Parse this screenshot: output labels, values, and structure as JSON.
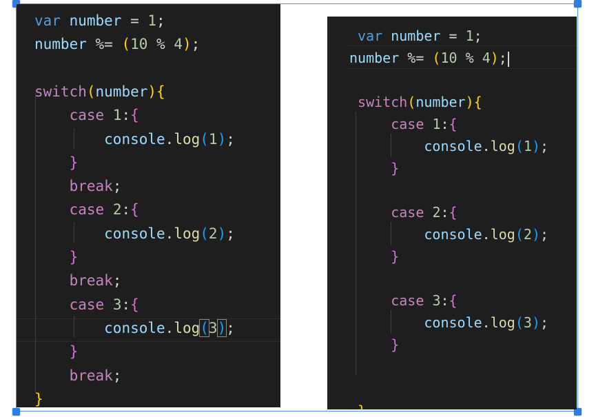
{
  "left_editor": {
    "lines": [
      {
        "t": [
          [
            "var",
            "kw-var"
          ],
          [
            " ",
            ""
          ],
          [
            "number",
            "ident"
          ],
          [
            " = ",
            ""
          ],
          [
            "1",
            "num"
          ],
          [
            ";",
            ""
          ]
        ]
      },
      {
        "t": [
          [
            "number",
            "ident"
          ],
          [
            " %= ",
            ""
          ],
          [
            "(",
            "brace"
          ],
          [
            "10",
            "num"
          ],
          [
            " % ",
            ""
          ],
          [
            "4",
            "num"
          ],
          [
            ")",
            "brace"
          ],
          [
            ";",
            ""
          ]
        ]
      },
      {
        "t": []
      },
      {
        "t": [
          [
            "switch",
            "kw-ctrl"
          ],
          [
            "(",
            "brace"
          ],
          [
            "number",
            "ident"
          ],
          [
            ")",
            "brace"
          ],
          [
            "{",
            "brace"
          ]
        ]
      },
      {
        "t": [
          [
            "    ",
            ""
          ],
          [
            "case",
            "kw-ctrl"
          ],
          [
            " ",
            ""
          ],
          [
            "1",
            "num"
          ],
          [
            ":",
            ""
          ],
          [
            "{",
            "paren"
          ]
        ]
      },
      {
        "t": [
          [
            "        ",
            ""
          ],
          [
            "console",
            "ident"
          ],
          [
            ".",
            ""
          ],
          [
            "log",
            "fn"
          ],
          [
            "(",
            "paren2"
          ],
          [
            "1",
            "num"
          ],
          [
            ")",
            "paren2"
          ],
          [
            ";",
            ""
          ]
        ]
      },
      {
        "t": [
          [
            "    ",
            ""
          ],
          [
            "}",
            "paren"
          ]
        ]
      },
      {
        "t": [
          [
            "    ",
            ""
          ],
          [
            "break",
            "kw-ctrl"
          ],
          [
            ";",
            ""
          ]
        ]
      },
      {
        "t": [
          [
            "    ",
            ""
          ],
          [
            "case",
            "kw-ctrl"
          ],
          [
            " ",
            ""
          ],
          [
            "2",
            "num"
          ],
          [
            ":",
            ""
          ],
          [
            "{",
            "paren"
          ]
        ]
      },
      {
        "t": [
          [
            "        ",
            ""
          ],
          [
            "console",
            "ident"
          ],
          [
            ".",
            ""
          ],
          [
            "log",
            "fn"
          ],
          [
            "(",
            "paren2"
          ],
          [
            "2",
            "num"
          ],
          [
            ")",
            "paren2"
          ],
          [
            ";",
            ""
          ]
        ]
      },
      {
        "t": [
          [
            "    ",
            ""
          ],
          [
            "}",
            "paren"
          ]
        ]
      },
      {
        "t": [
          [
            "    ",
            ""
          ],
          [
            "break",
            "kw-ctrl"
          ],
          [
            ";",
            ""
          ]
        ]
      },
      {
        "t": [
          [
            "    ",
            ""
          ],
          [
            "case",
            "kw-ctrl"
          ],
          [
            " ",
            ""
          ],
          [
            "3",
            "num"
          ],
          [
            ":",
            ""
          ],
          [
            "{",
            "paren"
          ]
        ]
      },
      {
        "t": [
          [
            "        ",
            ""
          ],
          [
            "console",
            "ident"
          ],
          [
            ".",
            ""
          ],
          [
            "log",
            "fn"
          ],
          [
            "(",
            "paren2 bracket-box"
          ],
          [
            "3",
            "num"
          ],
          [
            ")",
            "paren2 bracket-box"
          ],
          [
            ";",
            ""
          ]
        ]
      },
      {
        "t": [
          [
            "    ",
            ""
          ],
          [
            "}",
            "paren"
          ]
        ]
      },
      {
        "t": [
          [
            "    ",
            ""
          ],
          [
            "break",
            "kw-ctrl"
          ],
          [
            ";",
            ""
          ]
        ]
      },
      {
        "t": [
          [
            "}",
            "brace"
          ]
        ]
      }
    ]
  },
  "right_editor": {
    "lines": [
      {
        "t": [
          [
            " ",
            ""
          ],
          [
            "var",
            "kw-var"
          ],
          [
            " ",
            ""
          ],
          [
            "number",
            "ident"
          ],
          [
            " = ",
            ""
          ],
          [
            "1",
            "num"
          ],
          [
            ";",
            ""
          ]
        ]
      },
      {
        "t": [
          [
            "number",
            "ident"
          ],
          [
            " %= ",
            ""
          ],
          [
            "(",
            "brace"
          ],
          [
            "10",
            "num"
          ],
          [
            " % ",
            ""
          ],
          [
            "4",
            "num"
          ],
          [
            ")",
            "brace"
          ],
          [
            ";",
            ""
          ]
        ]
      },
      {
        "t": []
      },
      {
        "t": [
          [
            " ",
            ""
          ],
          [
            "switch",
            "kw-ctrl"
          ],
          [
            "(",
            "brace"
          ],
          [
            "number",
            "ident"
          ],
          [
            ")",
            "brace"
          ],
          [
            "{",
            "brace"
          ]
        ]
      },
      {
        "t": [
          [
            "     ",
            ""
          ],
          [
            "case",
            "kw-ctrl"
          ],
          [
            " ",
            ""
          ],
          [
            "1",
            "num"
          ],
          [
            ":",
            ""
          ],
          [
            "{",
            "paren"
          ]
        ]
      },
      {
        "t": [
          [
            "         ",
            ""
          ],
          [
            "console",
            "ident"
          ],
          [
            ".",
            ""
          ],
          [
            "log",
            "fn"
          ],
          [
            "(",
            "paren2"
          ],
          [
            "1",
            "num"
          ],
          [
            ")",
            "paren2"
          ],
          [
            ";",
            ""
          ]
        ]
      },
      {
        "t": [
          [
            "     ",
            ""
          ],
          [
            "}",
            "paren"
          ]
        ]
      },
      {
        "t": []
      },
      {
        "t": [
          [
            "     ",
            ""
          ],
          [
            "case",
            "kw-ctrl"
          ],
          [
            " ",
            ""
          ],
          [
            "2",
            "num"
          ],
          [
            ":",
            ""
          ],
          [
            "{",
            "paren"
          ]
        ]
      },
      {
        "t": [
          [
            "         ",
            ""
          ],
          [
            "console",
            "ident"
          ],
          [
            ".",
            ""
          ],
          [
            "log",
            "fn"
          ],
          [
            "(",
            "paren2"
          ],
          [
            "2",
            "num"
          ],
          [
            ")",
            "paren2"
          ],
          [
            ";",
            ""
          ]
        ]
      },
      {
        "t": [
          [
            "     ",
            ""
          ],
          [
            "}",
            "paren"
          ]
        ]
      },
      {
        "t": []
      },
      {
        "t": [
          [
            "     ",
            ""
          ],
          [
            "case",
            "kw-ctrl"
          ],
          [
            " ",
            ""
          ],
          [
            "3",
            "num"
          ],
          [
            ":",
            ""
          ],
          [
            "{",
            "paren"
          ]
        ]
      },
      {
        "t": [
          [
            "         ",
            ""
          ],
          [
            "console",
            "ident"
          ],
          [
            ".",
            ""
          ],
          [
            "log",
            "fn"
          ],
          [
            "(",
            "paren2"
          ],
          [
            "3",
            "num"
          ],
          [
            ")",
            "paren2"
          ],
          [
            ";",
            ""
          ]
        ]
      },
      {
        "t": [
          [
            "     ",
            ""
          ],
          [
            "}",
            "paren"
          ]
        ]
      },
      {
        "t": []
      },
      {
        "t": []
      },
      {
        "t": [
          [
            " ",
            ""
          ],
          [
            "}",
            "brace"
          ]
        ]
      }
    ]
  },
  "colors": {
    "editor_background": "#1e1e1e",
    "keyword": "#569cd6",
    "control_keyword": "#c586c0",
    "identifier": "#9cdcfe",
    "function": "#dcdcaa",
    "number": "#b5cea8",
    "selection_border": "#4a90e2"
  }
}
